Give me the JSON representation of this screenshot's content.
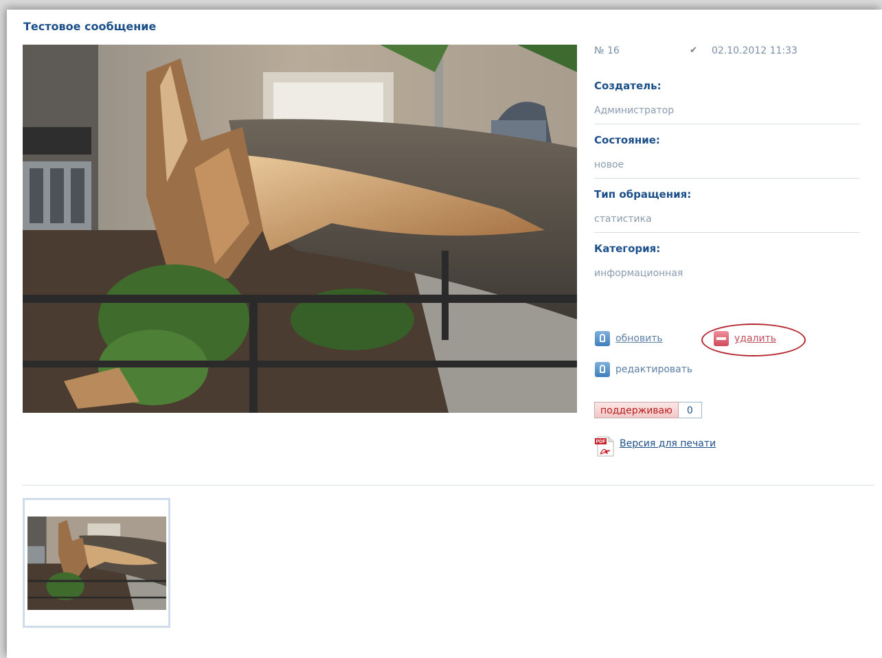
{
  "message": {
    "title": "Тестовое сообщение",
    "number": "№ 16",
    "date": "02.10.2012 11:33"
  },
  "fields": [
    {
      "label": "Создатель:",
      "value": "Администратор"
    },
    {
      "label": "Состояние:",
      "value": "новое"
    },
    {
      "label": "Тип обращения:",
      "value": "статистика"
    },
    {
      "label": "Категория:",
      "value": "информационная"
    }
  ],
  "actions": {
    "update": "обновить",
    "delete": "удалить",
    "edit": "редактировать"
  },
  "support": {
    "label": "поддерживаю",
    "count": "0"
  },
  "print": {
    "label": "Версия для печати",
    "icon_text": "PDF"
  },
  "icons": {
    "check": "check-icon",
    "update": "update-icon",
    "delete": "delete-icon",
    "edit": "edit-icon",
    "pdf": "pdf-icon"
  },
  "colors": {
    "heading": "#1b4f8a",
    "value": "#8a9bb0",
    "delete": "#c44d5a",
    "highlight_circle": "#b3262f"
  }
}
